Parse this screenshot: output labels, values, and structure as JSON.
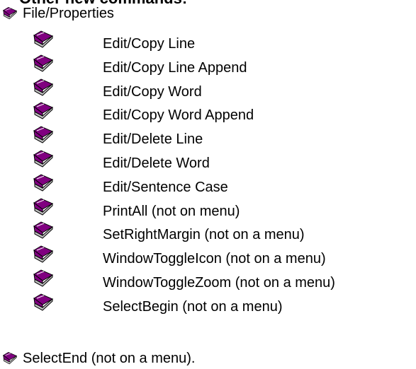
{
  "heading": "Other new commands:",
  "first_item": "File/Properties",
  "items": [
    "Edit/Copy Line",
    "Edit/Copy Line Append",
    "Edit/Copy Word",
    "Edit/Copy Word Append",
    "Edit/Delete Line",
    "Edit/Delete Word",
    "Edit/Sentence Case",
    "PrintAll (not on menu)",
    "SetRightMargin (not on a menu)",
    "WindowToggleIcon (not on a menu)",
    "WindowToggleZoom (not on a menu)",
    "SelectBegin (not on a menu)"
  ],
  "last_item": "SelectEnd (not on a menu).",
  "colors": {
    "book_cover": "#800080",
    "book_pages": "#c0c0c0",
    "text": "#000000"
  },
  "icon": "book-icon"
}
